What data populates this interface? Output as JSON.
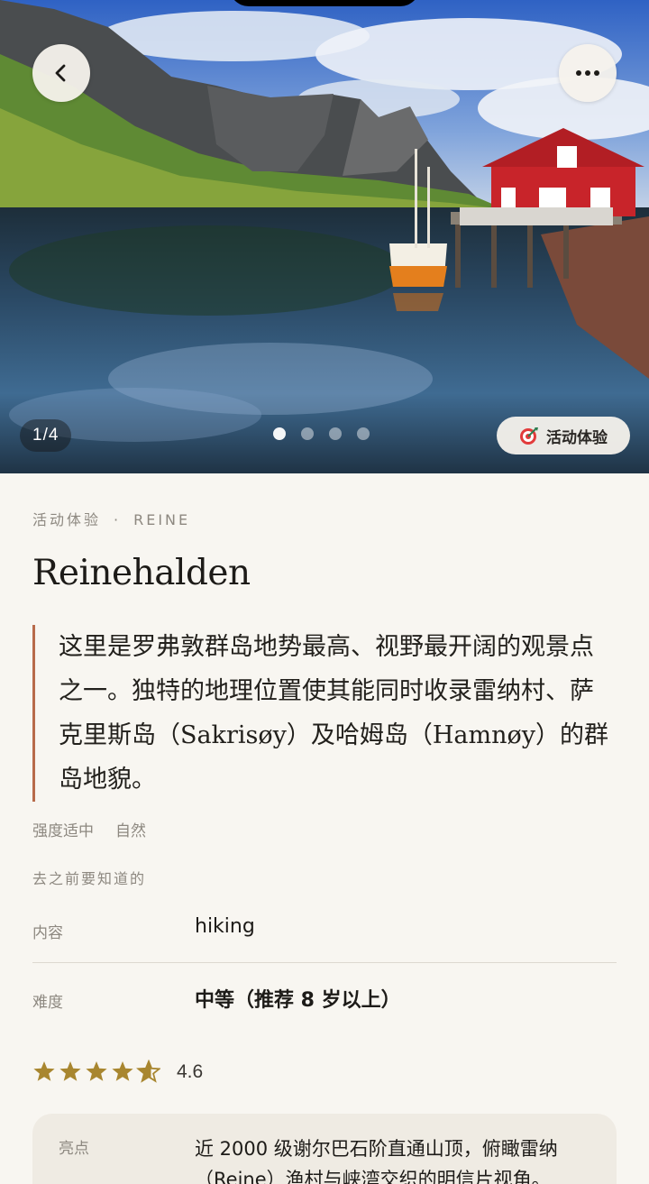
{
  "hero": {
    "counter": "1/4",
    "dots_total": 4,
    "dots_active": 1,
    "tag_label": "活动体验"
  },
  "nav": {
    "back_icon": "chevron-left-icon",
    "more_icon": "more-horizontal-icon"
  },
  "header": {
    "category": "活动体验",
    "separator": "·",
    "location": "REINE",
    "title": "Reinehalden"
  },
  "description": "这里是罗弗敦群岛地势最高、视野最开阔的观景点之一。独特的地理位置使其能同时收录雷纳村、萨克里斯岛（Sakrisøy）及哈姆岛（Hamnøy）的群岛地貌。",
  "meta": {
    "intensity": "强度适中",
    "type": "自然"
  },
  "info": {
    "section_label": "去之前要知道的",
    "rows": [
      {
        "label": "内容",
        "value": "hiking"
      },
      {
        "label": "难度",
        "value": "中等（推荐 8 岁以上）"
      }
    ]
  },
  "rating": {
    "value": "4.6",
    "stars": 4.6,
    "star_color": "#a8862f"
  },
  "highlight": {
    "label": "亮点",
    "text": "近 2000 级谢尔巴石阶直通山顶，俯瞰雷纳（Reine）渔村与峡湾交织的明信片视角。"
  },
  "colors": {
    "background": "#f8f6f1",
    "accent": "#b86b4b",
    "card": "#efebe3"
  }
}
